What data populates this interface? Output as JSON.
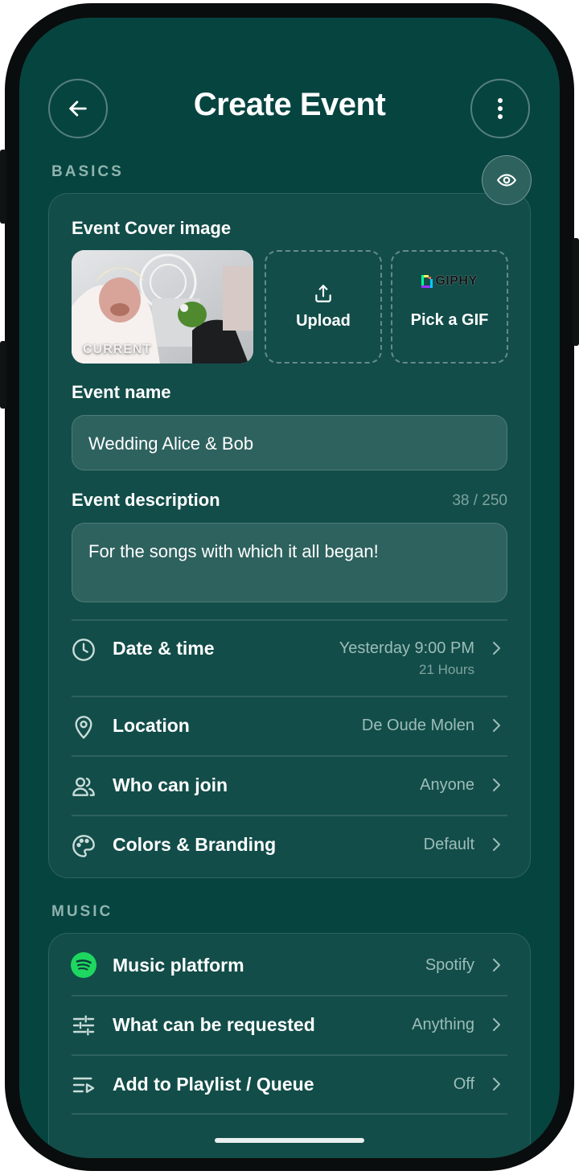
{
  "header": {
    "title": "Create Event",
    "back_icon": "arrow-left-icon",
    "menu_icon": "more-vertical-icon"
  },
  "basics": {
    "section_label": "BASICS",
    "preview_icon": "eye-icon",
    "cover": {
      "label": "Event Cover image",
      "current_tag": "CURRENT",
      "upload_label": "Upload",
      "giphy_brand": "GIPHY",
      "gif_label": "Pick a GIF"
    },
    "name": {
      "label": "Event name",
      "value": "Wedding Alice & Bob"
    },
    "description": {
      "label": "Event description",
      "counter": "38 / 250",
      "value": "For the songs with which it all began!"
    },
    "rows": [
      {
        "icon": "clock-icon",
        "label": "Date & time",
        "value": "Yesterday 9:00 PM",
        "sub": "21 Hours"
      },
      {
        "icon": "map-pin-icon",
        "label": "Location",
        "value": "De Oude Molen"
      },
      {
        "icon": "users-icon",
        "label": "Who can join",
        "value": "Anyone"
      },
      {
        "icon": "palette-icon",
        "label": "Colors & Branding",
        "value": "Default"
      }
    ]
  },
  "music": {
    "section_label": "MUSIC",
    "rows": [
      {
        "icon": "spotify-icon",
        "label": "Music platform",
        "value": "Spotify"
      },
      {
        "icon": "sliders-icon",
        "label": "What can be requested",
        "value": "Anything"
      },
      {
        "icon": "playlist-icon",
        "label": "Add to Playlist / Queue",
        "value": "Off"
      }
    ]
  },
  "colors": {
    "background": "#064440",
    "card": "#124d49",
    "input": "#2e625e",
    "spotify_green": "#1ed760"
  }
}
